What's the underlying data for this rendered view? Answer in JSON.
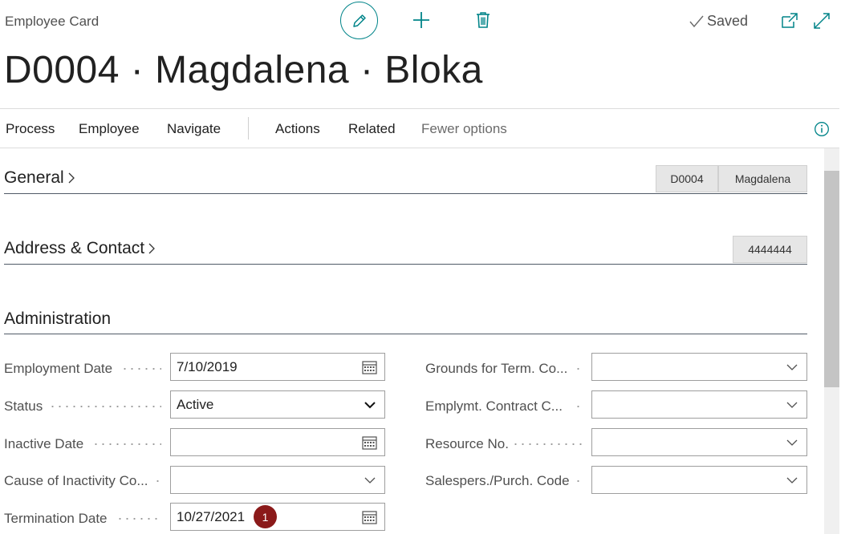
{
  "header": {
    "page_kind": "Employee Card",
    "saved_label": "Saved",
    "title": "D0004 · Magdalena · Bloka"
  },
  "actions": {
    "items": [
      "Process",
      "Employee",
      "Navigate",
      "Actions",
      "Related",
      "Fewer options"
    ]
  },
  "sections": {
    "general": {
      "title": "General",
      "facts": [
        "D0004",
        "Magdalena"
      ]
    },
    "address": {
      "title": "Address & Contact",
      "facts": [
        "4444444"
      ]
    },
    "administration": {
      "title": "Administration"
    }
  },
  "fields_left": [
    {
      "label": "Employment Date",
      "value": "7/10/2019",
      "kind": "date"
    },
    {
      "label": "Status",
      "value": "Active",
      "kind": "select"
    },
    {
      "label": "Inactive Date",
      "value": "",
      "kind": "date"
    },
    {
      "label": "Cause of Inactivity Co...",
      "value": "",
      "kind": "lookup"
    },
    {
      "label": "Termination Date",
      "value": "10/27/2021",
      "kind": "date"
    }
  ],
  "fields_right": [
    {
      "label": "Grounds for Term. Co...",
      "value": "",
      "kind": "lookup"
    },
    {
      "label": "Emplymt. Contract C...",
      "value": "",
      "kind": "lookup"
    },
    {
      "label": "Resource No.",
      "value": "",
      "kind": "lookup"
    },
    {
      "label": "Salespers./Purch. Code",
      "value": "",
      "kind": "lookup"
    }
  ],
  "annotation_badge": "1",
  "colors": {
    "accent": "#008489",
    "badge": "#8b1a1a"
  },
  "icons": [
    "edit-icon",
    "plus-icon",
    "trash-icon",
    "checkmark-icon",
    "open-new-window-icon",
    "expand-icon",
    "info-icon",
    "calendar-icon",
    "chevron-down-icon",
    "chevron-right-icon"
  ]
}
